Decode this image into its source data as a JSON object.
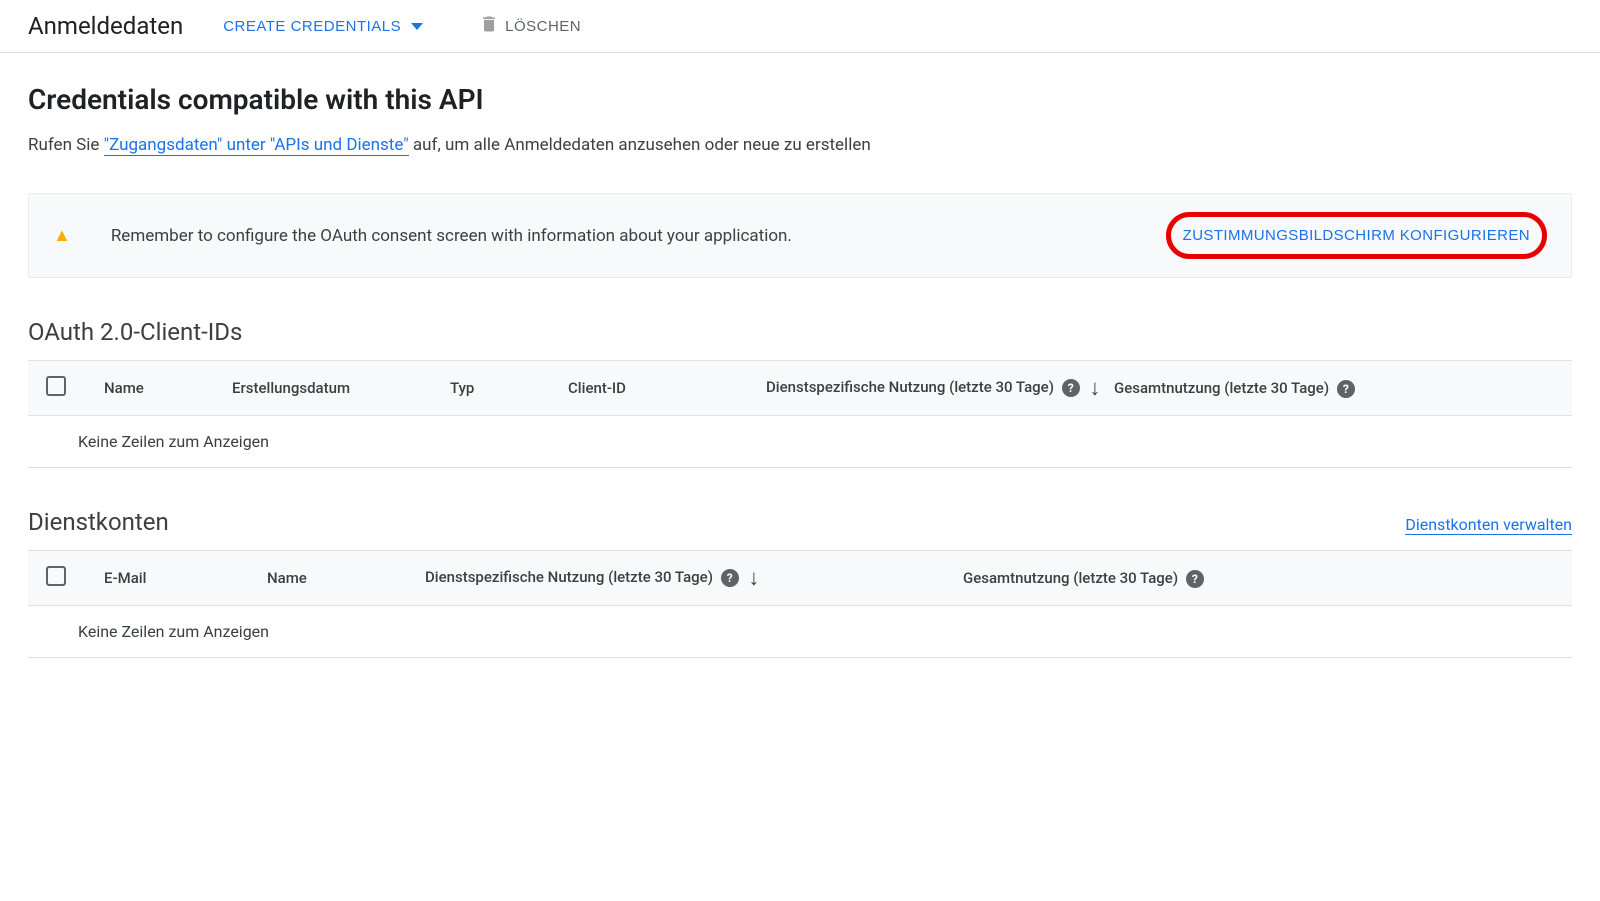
{
  "toolbar": {
    "title": "Anmeldedaten",
    "create_label": "CREATE CREDENTIALS",
    "delete_label": "LÖSCHEN"
  },
  "main": {
    "heading": "Credentials compatible with this API",
    "subtitle_pre": "Rufen Sie ",
    "subtitle_link": "\"Zugangsdaten\" unter \"APIs und Dienste\"",
    "subtitle_post": " auf, um alle Anmeldedaten anzusehen oder neue zu erstellen"
  },
  "alert": {
    "text": "Remember to configure the OAuth consent screen with information about your application.",
    "button": "ZUSTIMMUNGSBILDSCHIRM KONFIGURIEREN"
  },
  "oauth_table": {
    "title": "OAuth 2.0-Client-IDs",
    "cols": {
      "name": "Name",
      "date": "Erstellungsdatum",
      "typ": "Typ",
      "client_id": "Client-ID",
      "usage_service": "Dienstspezifische Nutzung (letzte 30 Tage)",
      "usage_total": "Gesamtnutzung (letzte 30 Tage)"
    },
    "empty": "Keine Zeilen zum Anzeigen"
  },
  "svc_table": {
    "title": "Dienstkonten",
    "manage_link": "Dienstkonten verwalten",
    "cols": {
      "email": "E-Mail",
      "name": "Name",
      "usage_service": "Dienstspezifische Nutzung (letzte 30 Tage)",
      "usage_total": "Gesamtnutzung (letzte 30 Tage)"
    },
    "empty": "Keine Zeilen zum Anzeigen"
  }
}
